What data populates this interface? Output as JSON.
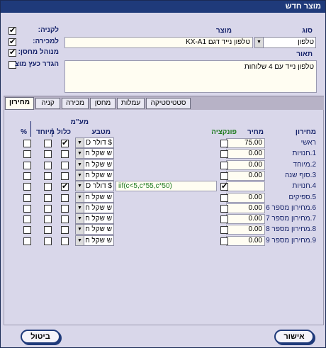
{
  "window": {
    "title": "מוצר חדש"
  },
  "header": {
    "type_label": "סוג",
    "type_value": "טלפון",
    "product_label": "מוצר",
    "code_value": "KX-A1",
    "name_value": "טלפון נייד דגם",
    "description_label": "תאור",
    "description_value": "טלפון נייד עם 4 שלוחות"
  },
  "flags": {
    "purchase_label": "לקניה:",
    "purchase_checked": true,
    "sale_label": "למכירה:",
    "sale_checked": true,
    "stock_label": "מנוהל מחסן:",
    "stock_checked": true,
    "define_label": "הגדר כעץ מוצ",
    "define_checked": false
  },
  "tabs": [
    {
      "label": "סטטיסטיקה",
      "active": false
    },
    {
      "label": "עמלות",
      "active": false
    },
    {
      "label": "מחסן",
      "active": false
    },
    {
      "label": "מכירה",
      "active": false
    },
    {
      "label": "קניה",
      "active": false
    },
    {
      "label": "מחירון",
      "active": true
    }
  ],
  "pricelist_table": {
    "col_pricelist": "מחירון",
    "col_price": "מחיר",
    "col_function": "פונקציה",
    "col_currency": "מטבע",
    "col_vat": "מע\"מ",
    "col_vat_included": "כלול",
    "col_special": "מיוחד",
    "col_percent": "%",
    "rows": [
      {
        "name": "ראשי",
        "price": "75.00",
        "func_checked": false,
        "formula": "",
        "currency": "$ דולר D",
        "vat_checked": true,
        "special_checked": false,
        "percent_checked": false
      },
      {
        "name": "1.חנויות",
        "price": "0.00",
        "func_checked": false,
        "formula": "",
        "currency": "ש שקל ח",
        "vat_checked": false,
        "special_checked": false,
        "percent_checked": false
      },
      {
        "name": "2.מיוחד",
        "price": "0.00",
        "func_checked": false,
        "formula": "",
        "currency": "ש שקל ח",
        "vat_checked": false,
        "special_checked": false,
        "percent_checked": false
      },
      {
        "name": "3.סוף שנה",
        "price": "0.00",
        "func_checked": false,
        "formula": "",
        "currency": "ש שקל ח",
        "vat_checked": false,
        "special_checked": false,
        "percent_checked": false
      },
      {
        "name": "4.חנויות",
        "price": "",
        "func_checked": true,
        "formula": "iif(c<5,c*55,c*50)",
        "currency": "$ דולר D",
        "vat_checked": true,
        "special_checked": false,
        "percent_checked": false
      },
      {
        "name": "5.ספיקים",
        "price": "0.00",
        "func_checked": false,
        "formula": "",
        "currency": "ש שקל ח",
        "vat_checked": false,
        "special_checked": false,
        "percent_checked": false
      },
      {
        "name": "6.מחירון מספר 6",
        "price": "0.00",
        "func_checked": false,
        "formula": "",
        "currency": "ש שקל ח",
        "vat_checked": false,
        "special_checked": false,
        "percent_checked": false
      },
      {
        "name": "7.מחירון מספר 7",
        "price": "0.00",
        "func_checked": false,
        "formula": "",
        "currency": "ש שקל ח",
        "vat_checked": false,
        "special_checked": false,
        "percent_checked": false
      },
      {
        "name": "8.מחירון מספר 8",
        "price": "0.00",
        "func_checked": false,
        "formula": "",
        "currency": "ש שקל ח",
        "vat_checked": false,
        "special_checked": false,
        "percent_checked": false
      },
      {
        "name": "9.מחירון מספר 9",
        "price": "0.00",
        "func_checked": false,
        "formula": "",
        "currency": "ש שקל ח",
        "vat_checked": false,
        "special_checked": false,
        "percent_checked": false
      }
    ]
  },
  "footer": {
    "ok_label": "אישור",
    "cancel_label": "ביטול"
  },
  "icons": {
    "dropdown": "triangle-down-icon"
  }
}
